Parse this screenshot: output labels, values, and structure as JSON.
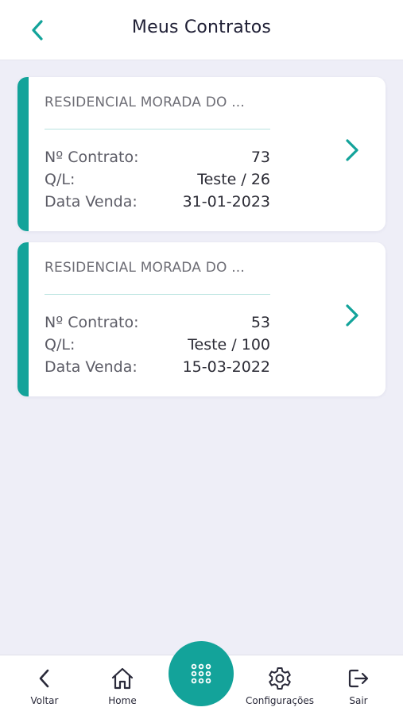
{
  "header": {
    "title": "Meus Contratos",
    "back_icon": "chevron-left-icon"
  },
  "theme": {
    "accent": "#13a39a",
    "background": "#eeeef7",
    "card": "#ffffff"
  },
  "contracts": [
    {
      "title": "RESIDENCIAL MORADA DO ...",
      "contract_label": "Nº Contrato:",
      "contract_value": "73",
      "ql_label": "Q/L:",
      "ql_value": "Teste / 26",
      "date_label": "Data Venda:",
      "date_value": "31-01-2023"
    },
    {
      "title": "RESIDENCIAL MORADA DO ...",
      "contract_label": "Nº Contrato:",
      "contract_value": "53",
      "ql_label": "Q/L:",
      "ql_value": "Teste / 100",
      "date_label": "Data Venda:",
      "date_value": "15-03-2022"
    }
  ],
  "nav": {
    "back": "Voltar",
    "home": "Home",
    "settings": "Configurações",
    "logout": "Sair",
    "menu_icon": "grid-dots-icon"
  }
}
